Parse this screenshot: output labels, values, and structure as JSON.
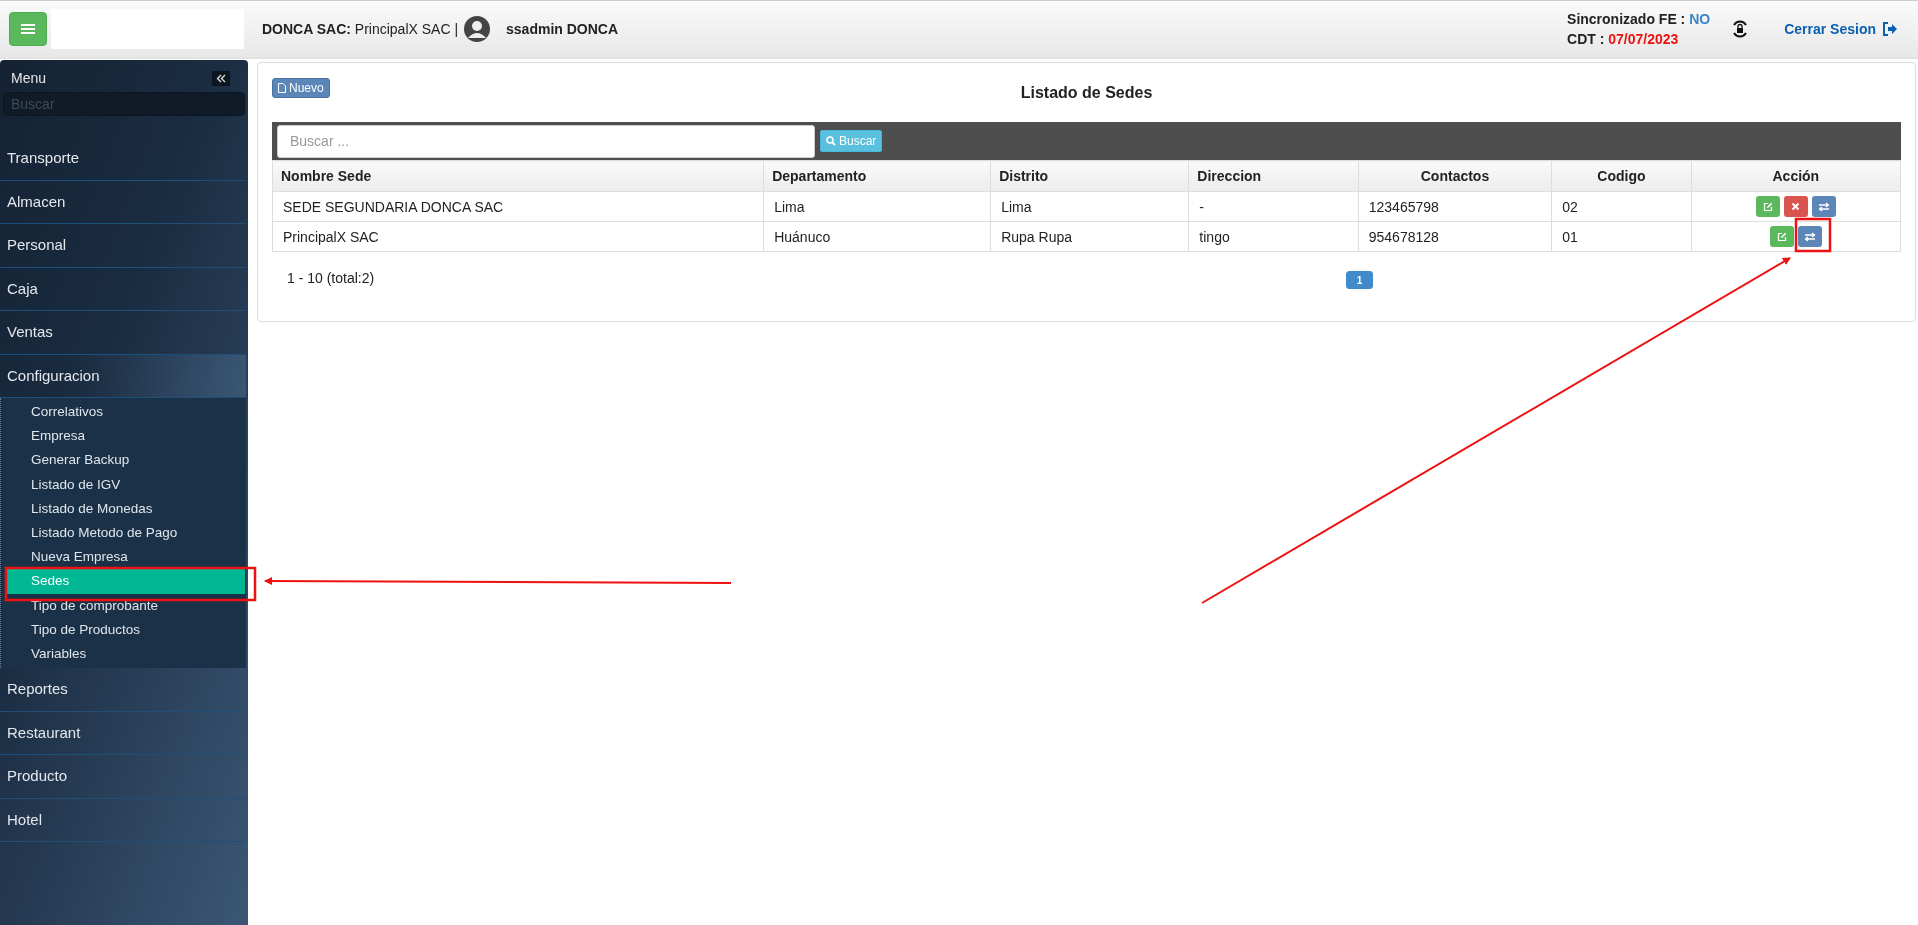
{
  "header": {
    "company_label": "DONCA SAC:",
    "company": "PrincipalX SAC |",
    "user": "ssadmin DONCA",
    "sync_label": "Sincronizado FE :",
    "sync_value": "NO",
    "cdt_label": "CDT :",
    "cdt_value": "07/07/2023",
    "logout": "Cerrar Sesion"
  },
  "sidebar": {
    "title": "Menu",
    "search": {
      "placeholder": "Buscar"
    },
    "items": [
      {
        "label": "Transporte",
        "expanded": false
      },
      {
        "label": "Almacen",
        "expanded": false
      },
      {
        "label": "Personal",
        "expanded": false
      },
      {
        "label": "Caja",
        "expanded": false
      },
      {
        "label": "Ventas",
        "expanded": false
      },
      {
        "label": "Configuracion",
        "expanded": true,
        "children": [
          {
            "label": "Correlativos",
            "selected": false
          },
          {
            "label": "Empresa",
            "selected": false
          },
          {
            "label": "Generar Backup",
            "selected": false
          },
          {
            "label": "Listado de IGV",
            "selected": false
          },
          {
            "label": "Listado de Monedas",
            "selected": false
          },
          {
            "label": "Listado Metodo de Pago",
            "selected": false
          },
          {
            "label": "Nueva Empresa",
            "selected": false
          },
          {
            "label": "Sedes",
            "selected": true
          },
          {
            "label": "Tipo de comprobante",
            "selected": false
          },
          {
            "label": "Tipo de Productos",
            "selected": false
          },
          {
            "label": "Variables",
            "selected": false
          }
        ]
      },
      {
        "label": "Reportes",
        "expanded": false
      },
      {
        "label": "Restaurant",
        "expanded": false
      },
      {
        "label": "Producto",
        "expanded": false
      },
      {
        "label": "Hotel",
        "expanded": false
      }
    ]
  },
  "page": {
    "title": "Listado de Sedes",
    "new_button": "Nuevo",
    "search": {
      "placeholder": "Buscar ...",
      "button": "Buscar"
    }
  },
  "table": {
    "columns": [
      "Nombre Sede",
      "Departamento",
      "Distrito",
      "Direccion",
      "Contactos",
      "Codigo",
      "Acción"
    ],
    "rows": [
      {
        "cells": [
          "SEDE SEGUNDARIA DONCA SAC",
          "Lima",
          "Lima",
          "-",
          "123465798",
          "02"
        ],
        "actions": [
          {
            "kind": "edit"
          },
          {
            "kind": "delete"
          },
          {
            "kind": "transfer"
          }
        ]
      },
      {
        "cells": [
          "PrincipalX SAC",
          "Huánuco",
          "Rupa Rupa",
          "tingo",
          "954678128",
          "01"
        ],
        "actions": [
          {
            "kind": "edit"
          },
          {
            "kind": "transfer"
          }
        ]
      }
    ]
  },
  "pagination": {
    "summary": "1 - 10 (total:2)",
    "pages": [
      {
        "label": "1",
        "selected": true
      }
    ]
  }
}
